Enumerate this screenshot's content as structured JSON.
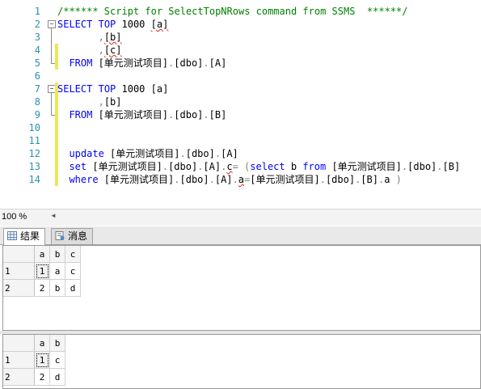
{
  "editor": {
    "line_numbers": [
      "1",
      "2",
      "3",
      "4",
      "5",
      "6",
      "7",
      "8",
      "9",
      "10",
      "11",
      "12",
      "13",
      "14"
    ],
    "lines": [
      [
        {
          "t": "/****** Script for SelectTopNRows command from SSMS  ******/",
          "c": "cm"
        }
      ],
      [
        {
          "t": "SELECT",
          "c": "kw"
        },
        {
          "t": " "
        },
        {
          "t": "TOP",
          "c": "kw"
        },
        {
          "t": " 1000 "
        },
        {
          "t": "[a]",
          "c": "sq"
        }
      ],
      [
        {
          "t": "       "
        },
        {
          "t": ",",
          "c": "op"
        },
        {
          "t": "[b]",
          "c": "sq"
        }
      ],
      [
        {
          "t": "       "
        },
        {
          "t": ",",
          "c": "op"
        },
        {
          "t": "[c]",
          "c": "sq"
        }
      ],
      [
        {
          "t": "  "
        },
        {
          "t": "FROM",
          "c": "kw"
        },
        {
          "t": " [单元测试项目]"
        },
        {
          "t": ".",
          "c": "op"
        },
        {
          "t": "[dbo]"
        },
        {
          "t": ".",
          "c": "op"
        },
        {
          "t": "[A]"
        }
      ],
      [],
      [
        {
          "t": "SELECT",
          "c": "kw"
        },
        {
          "t": " "
        },
        {
          "t": "TOP",
          "c": "kw"
        },
        {
          "t": " 1000 [a]"
        }
      ],
      [
        {
          "t": "       "
        },
        {
          "t": ",",
          "c": "op"
        },
        {
          "t": "[b]"
        }
      ],
      [
        {
          "t": "  "
        },
        {
          "t": "FROM",
          "c": "kw"
        },
        {
          "t": " [单元测试项目]"
        },
        {
          "t": ".",
          "c": "op"
        },
        {
          "t": "[dbo]"
        },
        {
          "t": ".",
          "c": "op"
        },
        {
          "t": "[B]"
        }
      ],
      [],
      [],
      [
        {
          "t": "  "
        },
        {
          "t": "update",
          "c": "kw"
        },
        {
          "t": " [单元测试项目]"
        },
        {
          "t": ".",
          "c": "op"
        },
        {
          "t": "[dbo]"
        },
        {
          "t": ".",
          "c": "op"
        },
        {
          "t": "[A]"
        }
      ],
      [
        {
          "t": "  "
        },
        {
          "t": "set",
          "c": "kw"
        },
        {
          "t": " [单元测试项目]"
        },
        {
          "t": ".",
          "c": "op"
        },
        {
          "t": "[dbo]"
        },
        {
          "t": ".",
          "c": "op"
        },
        {
          "t": "[A]"
        },
        {
          "t": ".",
          "c": "op"
        },
        {
          "t": "c",
          "c": "sq"
        },
        {
          "t": "=",
          "c": "op"
        },
        {
          "t": " "
        },
        {
          "t": "(",
          "c": "op"
        },
        {
          "t": "select",
          "c": "kw"
        },
        {
          "t": " b "
        },
        {
          "t": "from",
          "c": "kw"
        },
        {
          "t": " [单元测试项目]"
        },
        {
          "t": ".",
          "c": "op"
        },
        {
          "t": "[dbo]"
        },
        {
          "t": ".",
          "c": "op"
        },
        {
          "t": "[B]"
        }
      ],
      [
        {
          "t": "  "
        },
        {
          "t": "where",
          "c": "kw"
        },
        {
          "t": " [单元测试项目]"
        },
        {
          "t": ".",
          "c": "op"
        },
        {
          "t": "[dbo]"
        },
        {
          "t": ".",
          "c": "op"
        },
        {
          "t": "[A]"
        },
        {
          "t": ".",
          "c": "op"
        },
        {
          "t": "a",
          "c": "sq"
        },
        {
          "t": "=",
          "c": "op"
        },
        {
          "t": "[单元测试项目]"
        },
        {
          "t": ".",
          "c": "op"
        },
        {
          "t": "[dbo]"
        },
        {
          "t": ".",
          "c": "op"
        },
        {
          "t": "[B]"
        },
        {
          "t": ".",
          "c": "op"
        },
        {
          "t": "a "
        },
        {
          "t": ")",
          "c": "op"
        }
      ]
    ]
  },
  "status": {
    "zoom": "100 %"
  },
  "tabs": [
    {
      "label": "结果",
      "icon": "grid-icon",
      "active": true
    },
    {
      "label": "消息",
      "icon": "message-icon",
      "active": false
    }
  ],
  "result_sets": [
    {
      "columns": [
        "a",
        "b",
        "c"
      ],
      "rows": [
        {
          "n": "1",
          "cells": [
            "1",
            "a",
            "c"
          ]
        },
        {
          "n": "2",
          "cells": [
            "2",
            "b",
            "d"
          ]
        }
      ]
    },
    {
      "columns": [
        "a",
        "b"
      ],
      "rows": [
        {
          "n": "1",
          "cells": [
            "1",
            "c"
          ]
        },
        {
          "n": "2",
          "cells": [
            "2",
            "d"
          ]
        }
      ]
    }
  ],
  "colors": {
    "keyword": "#0000ff",
    "comment": "#008000",
    "line_number": "#2b91af",
    "change_bar": "#ece75a"
  }
}
